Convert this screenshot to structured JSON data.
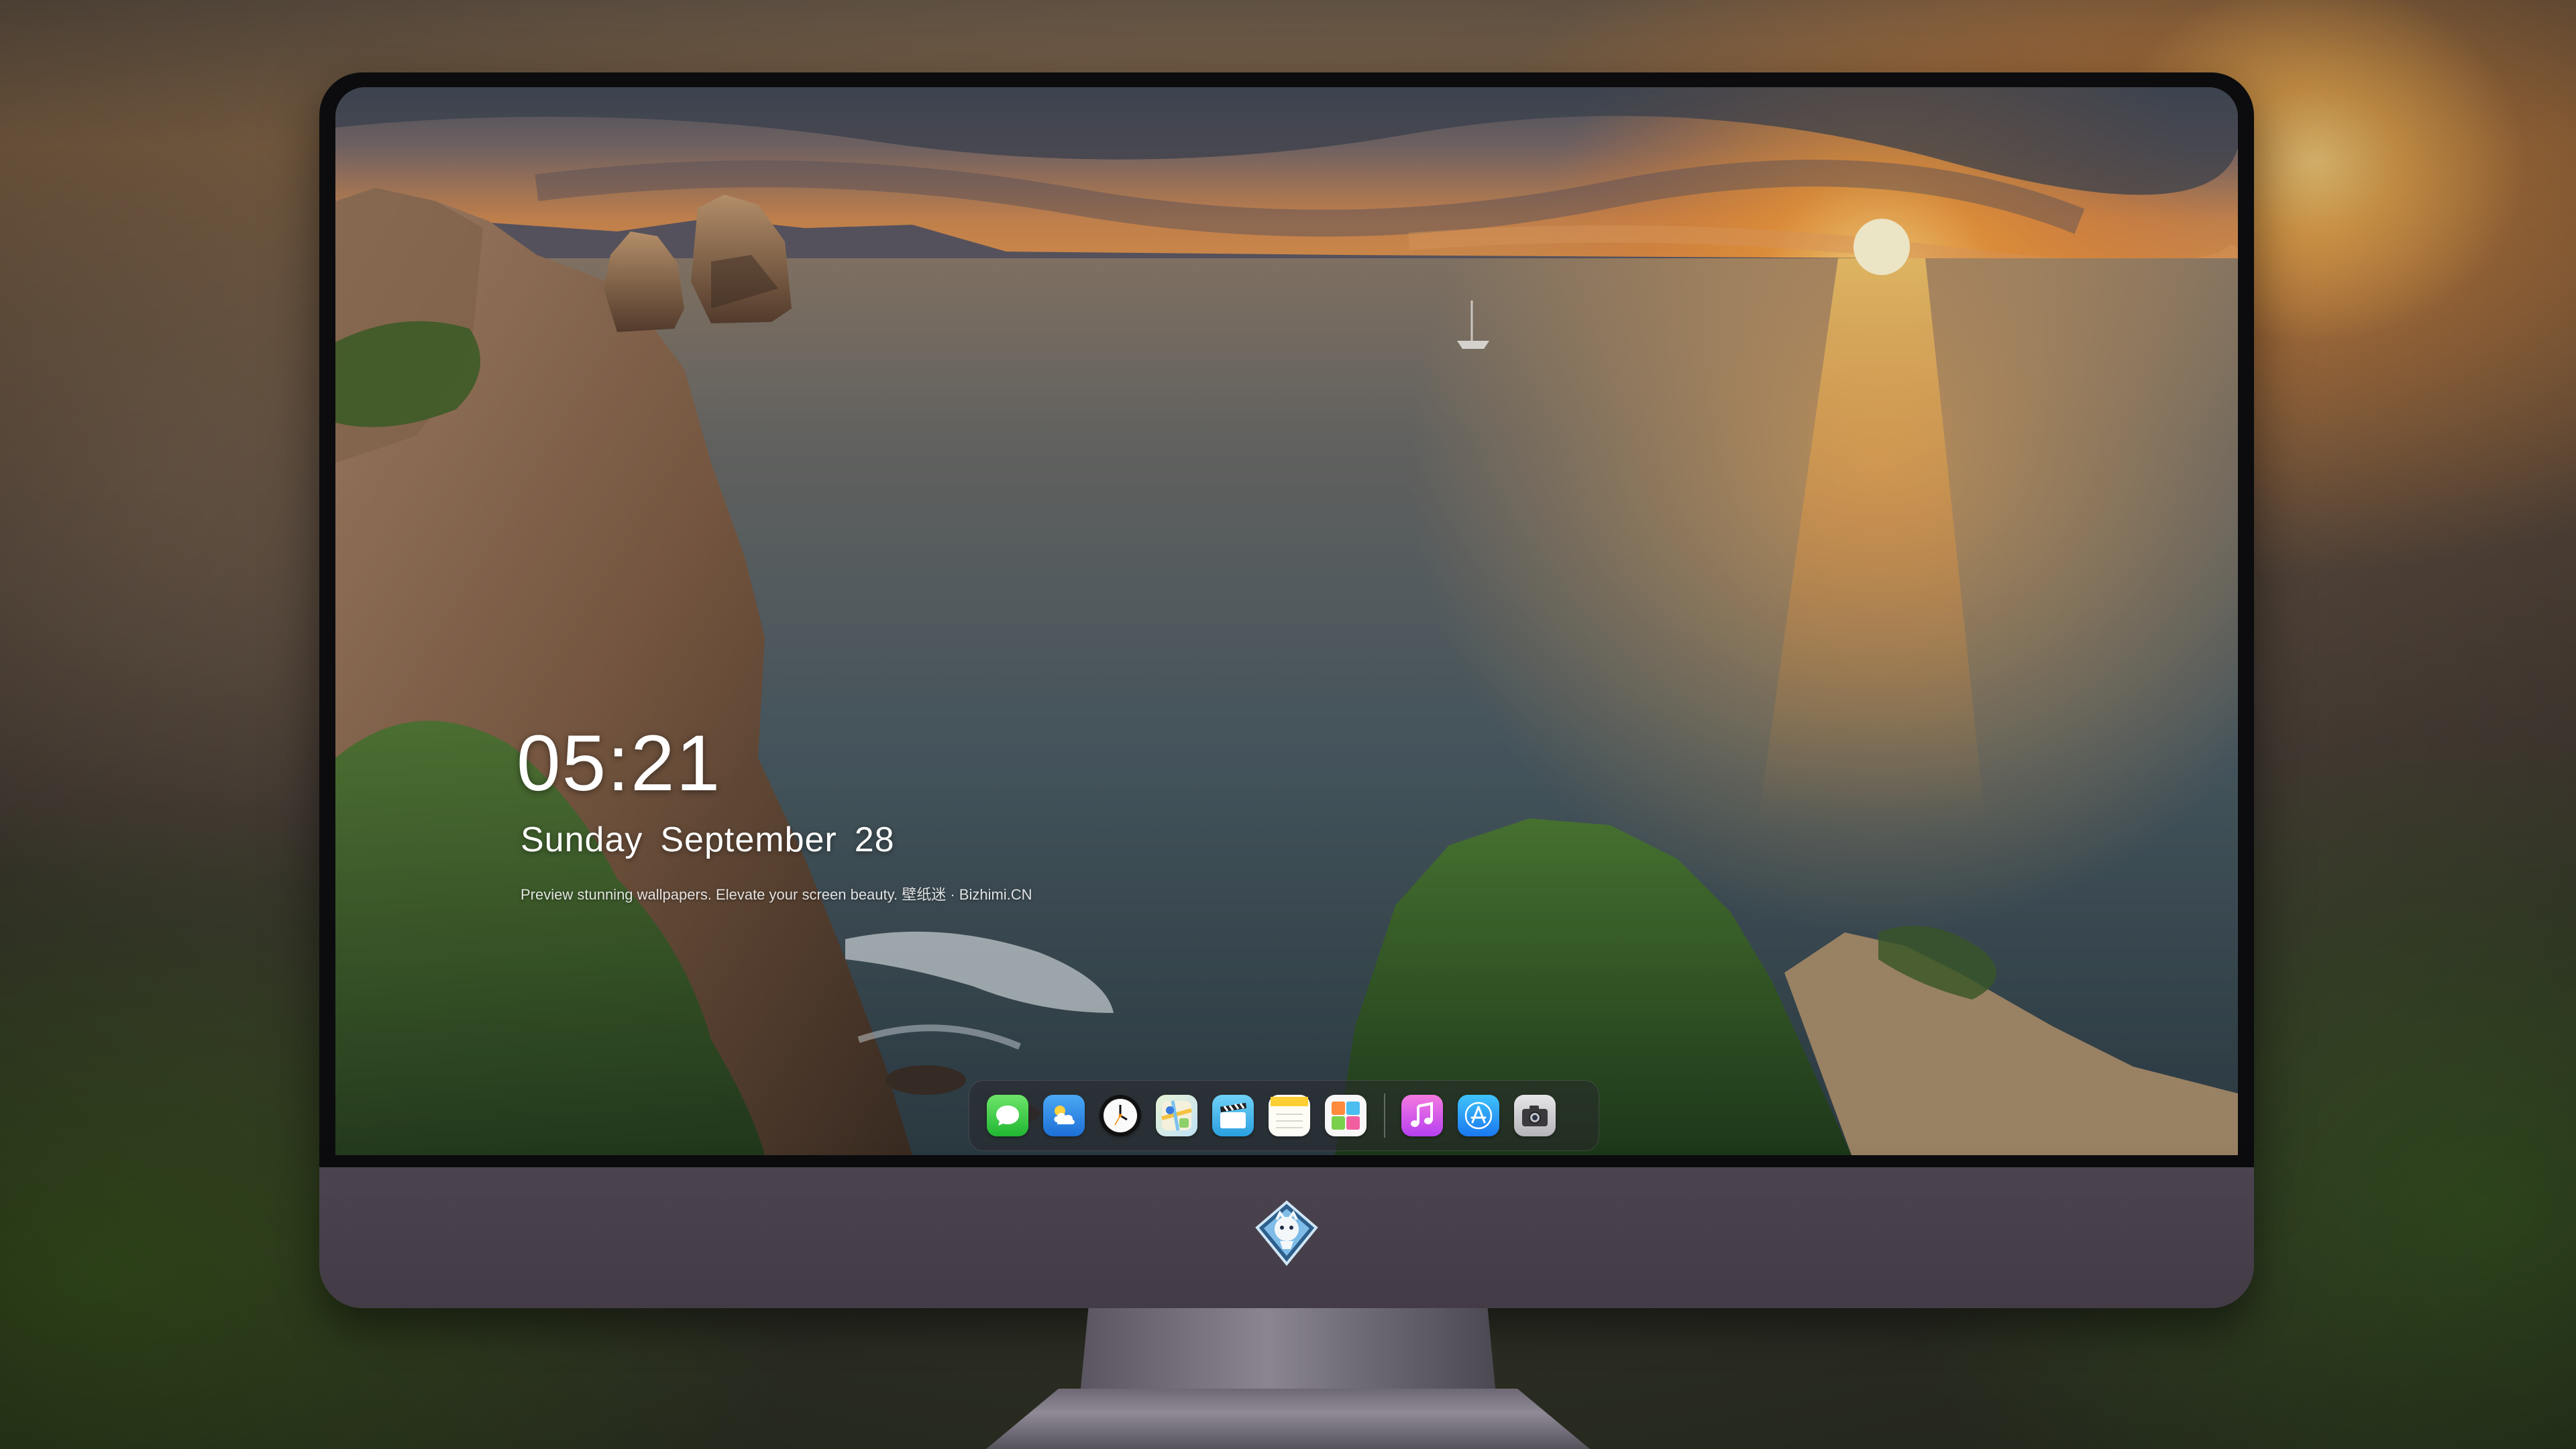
{
  "lock_screen": {
    "time": "05:21",
    "weekday": "Sunday",
    "month": "September",
    "day": "28",
    "tagline": "Preview stunning wallpapers. Elevate your screen beauty. 壁纸迷 · Bizhimi.CN"
  },
  "dock": {
    "apps": [
      {
        "name": "messages",
        "icon": "speech-bubble-icon"
      },
      {
        "name": "weather",
        "icon": "cloud-sun-icon"
      },
      {
        "name": "clock",
        "icon": "clock-icon"
      },
      {
        "name": "maps",
        "icon": "map-icon"
      },
      {
        "name": "video",
        "icon": "clapperboard-icon"
      },
      {
        "name": "notes",
        "icon": "notes-icon"
      },
      {
        "name": "photos",
        "icon": "photo-grid-icon"
      },
      {
        "name": "music",
        "icon": "music-note-icon"
      },
      {
        "name": "app-store",
        "icon": "app-store-icon"
      },
      {
        "name": "camera",
        "icon": "camera-icon"
      }
    ]
  },
  "colors": {
    "sunset_orange": "#f39a3a",
    "sea": "#3e5866",
    "monitor_chin": "#463f49",
    "bezel": "#0c0c0e"
  }
}
